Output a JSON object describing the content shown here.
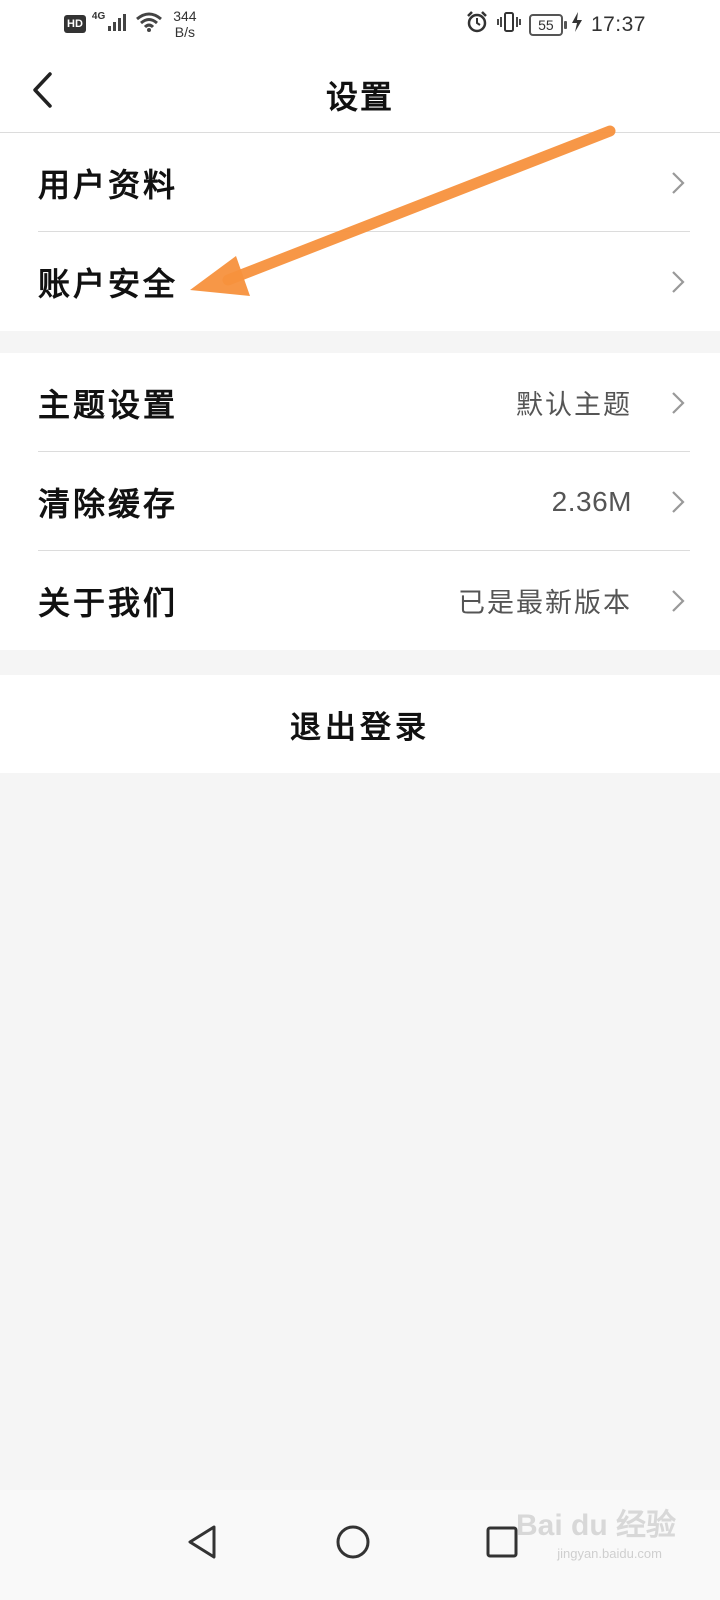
{
  "status_bar": {
    "hd_badge": "HD",
    "network_type": "4G",
    "speed_value": "344",
    "speed_unit": "B/s",
    "battery": "55",
    "time": "17:37",
    "icons": [
      "signal-icon",
      "wifi-icon",
      "alarm-icon",
      "vibrate-icon",
      "battery-icon",
      "charging-icon"
    ]
  },
  "header": {
    "title": "设置",
    "back_icon": "chevron-left-icon"
  },
  "groups": {
    "account": [
      {
        "label": "用户资料",
        "value": ""
      },
      {
        "label": "账户安全",
        "value": ""
      }
    ],
    "general": [
      {
        "label": "主题设置",
        "value": "默认主题"
      },
      {
        "label": "清除缓存",
        "value": "2.36M"
      },
      {
        "label": "关于我们",
        "value": "已是最新版本"
      }
    ]
  },
  "logout_label": "退出登录",
  "annotation": {
    "color": "#f7913d"
  },
  "nav_bar": {
    "icons": [
      "nav-back-icon",
      "nav-home-icon",
      "nav-recent-icon"
    ]
  },
  "watermark": {
    "logo_text": "Bai du 经验",
    "url": "jingyan.baidu.com"
  },
  "colors": {
    "background": "#f5f5f5",
    "surface": "#ffffff",
    "divider": "#dcdcdc",
    "secondary_text": "#555555"
  }
}
